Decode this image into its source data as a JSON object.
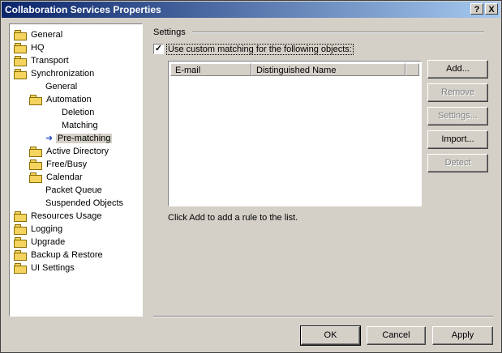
{
  "window": {
    "title": "Collaboration Services Properties",
    "help_label": "?",
    "close_label": "X"
  },
  "tree": {
    "items": [
      {
        "label": "General",
        "icon": "folder-icon"
      },
      {
        "label": "HQ",
        "icon": "folder-icon"
      },
      {
        "label": "Transport",
        "icon": "folder-icon"
      },
      {
        "label": "Synchronization",
        "icon": "folder-icon"
      },
      {
        "label": "General",
        "icon": "none"
      },
      {
        "label": "Automation",
        "icon": "folder-icon"
      },
      {
        "label": "Deletion",
        "icon": "none"
      },
      {
        "label": "Matching",
        "icon": "none"
      },
      {
        "label": "Pre-matching",
        "icon": "arrow-icon",
        "selected": true
      },
      {
        "label": "Active Directory",
        "icon": "folder-icon"
      },
      {
        "label": "Free/Busy",
        "icon": "folder-icon"
      },
      {
        "label": "Calendar",
        "icon": "folder-icon"
      },
      {
        "label": "Packet Queue",
        "icon": "none"
      },
      {
        "label": "Suspended Objects",
        "icon": "none"
      },
      {
        "label": "Resources Usage",
        "icon": "folder-icon"
      },
      {
        "label": "Logging",
        "icon": "folder-icon"
      },
      {
        "label": "Upgrade",
        "icon": "folder-icon"
      },
      {
        "label": "Backup & Restore",
        "icon": "folder-icon"
      },
      {
        "label": "UI Settings",
        "icon": "folder-icon"
      }
    ]
  },
  "settings": {
    "group_title": "Settings",
    "checkbox_label": "Use custom matching for the following objects:",
    "checkbox_checked": true,
    "checkmark": "✓",
    "columns": [
      "E-mail",
      "Distinguished Name"
    ],
    "hint": "Click Add to add a rule to the list."
  },
  "side_buttons": {
    "add": "Add...",
    "remove": "Remove",
    "settings": "Settings...",
    "import": "Import...",
    "detect": "Detect"
  },
  "footer": {
    "ok": "OK",
    "cancel": "Cancel",
    "apply": "Apply"
  }
}
